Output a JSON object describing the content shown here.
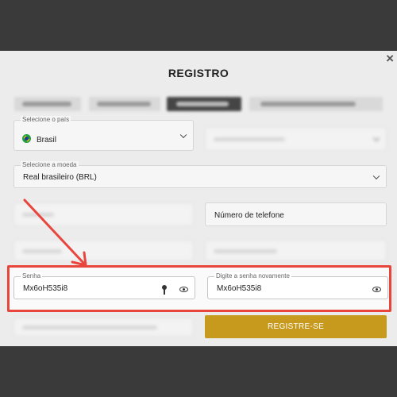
{
  "modal": {
    "title": "REGISTRO",
    "close_label": "×"
  },
  "tabs": [
    {
      "label": "",
      "active": false
    },
    {
      "label": "",
      "active": false
    },
    {
      "label": "",
      "active": true
    },
    {
      "label": "",
      "active": false
    }
  ],
  "form": {
    "country": {
      "label": "Selecione o país",
      "value": "Brasil",
      "flag": "brazil-flag"
    },
    "currency": {
      "label": "Selecione a moeda",
      "value": "Real brasileiro (BRL)"
    },
    "phone": {
      "placeholder": "Número de telefone"
    },
    "password": {
      "label": "Senha",
      "value": "Mx6oH535i8"
    },
    "password_repeat": {
      "label": "Digite a senha novamente",
      "value": "Mx6oH535i8"
    },
    "submit_label": "REGISTRE-SE"
  },
  "icons": {
    "eye": "eye-icon",
    "key": "key-icon",
    "chevron": "chevron-down-icon",
    "close": "close-icon"
  },
  "annotation": {
    "highlight_color": "#e8453c",
    "arrow_color": "#e8453c"
  },
  "colors": {
    "accent": "#c79a1e",
    "backdrop": "#3a3a3a"
  }
}
